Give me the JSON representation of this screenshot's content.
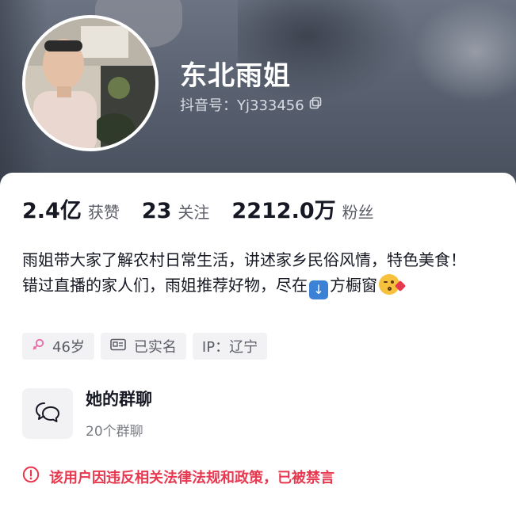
{
  "profile": {
    "nickname": "东北雨姐",
    "account_id": "抖音号：Yj333456"
  },
  "stats": [
    {
      "value": "2.4亿",
      "label": "获赞"
    },
    {
      "value": "23",
      "label": "关注"
    },
    {
      "value": "2212.0万",
      "label": "粉丝"
    }
  ],
  "bio": {
    "line1": "雨姐带大家了解农村日常生活，讲述家乡民俗风情，特色美食！",
    "line2_before": "错过直播的家人们，雨姐推荐好物，尽在",
    "line2_after": "方橱窗"
  },
  "tags": {
    "age": "46岁",
    "verified": "已实名",
    "ip": "IP：辽宁"
  },
  "group_chat": {
    "title": "她的群聊",
    "count": "20个群聊"
  },
  "ban_notice": "该用户因违反相关法律法规和政策，已被禁言",
  "colors": {
    "accent_red": "#e8384f",
    "gender_pink": "#e86aa6",
    "text_primary": "#161823",
    "text_secondary": "#5a5c66"
  },
  "icons": [
    "copy-icon",
    "female-icon",
    "id-card-icon",
    "chat-bubbles-icon",
    "warning-circle-icon",
    "down-arrow-emoji",
    "kiss-face-emoji"
  ]
}
